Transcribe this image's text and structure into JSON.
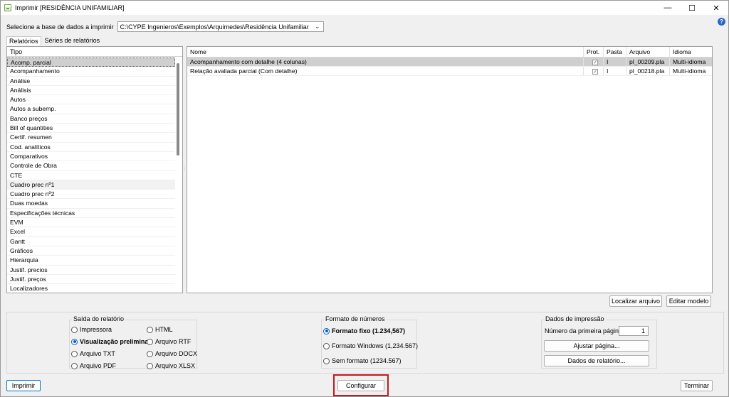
{
  "window": {
    "title": "Imprimir [RESIDÊNCIA UNIFAMILIAR]"
  },
  "database": {
    "label": "Selecione a base de dados a imprimir",
    "path": "C:\\CYPE Ingenieros\\Exemplos\\Arquimedes\\Residência Unifamiliar"
  },
  "tabs": [
    "Relatórios",
    "Séries de relatórios"
  ],
  "type_list": {
    "header": "Tipo",
    "items": [
      "Acomp. parcial",
      "Acompanhamento",
      "Análise",
      "Análisis",
      "Autos",
      "Autos a subemp.",
      "Banco preços",
      "Bill of quantities",
      "Certif. resumen",
      "Cod. analíticos",
      "Comparativos",
      "Controle de Obra",
      "CTE",
      "Cuadro prec nº1",
      "Cuadro prec nº2",
      "Duas moedas",
      "Especificações técnicas",
      "EVM",
      "Excel",
      "Gantt",
      "Gráficos",
      "Hierarquia",
      "Justif. precios",
      "Justif. preços",
      "Localizadores"
    ]
  },
  "reports_grid": {
    "columns": [
      "Nome",
      "Prot.",
      "Pasta",
      "Arquivo",
      "Idioma"
    ],
    "rows": [
      {
        "nome": "Acompanhamento com detalhe (4 colunas)",
        "pasta": "I",
        "arquivo": "pl_00209.pla",
        "idioma": "Multi-idioma"
      },
      {
        "nome": "Relação avaliada parcial (Com detalhe)",
        "pasta": "I",
        "arquivo": "pl_00218.pla",
        "idioma": "Multi-idioma"
      }
    ]
  },
  "buttons": {
    "localizar": "Localizar arquivo",
    "editar": "Editar modelo",
    "imprimir": "Imprimir",
    "configurar": "Configurar",
    "terminar": "Terminar",
    "ajustar": "Ajustar página...",
    "dados_relatorio": "Dados de relatório..."
  },
  "output": {
    "title": "Saída do relatório",
    "options": [
      "Impressora",
      "Visualização preliminar",
      "Arquivo TXT",
      "Arquivo PDF",
      "HTML",
      "Arquivo RTF",
      "Arquivo DOCX",
      "Arquivo XLSX"
    ],
    "selected": "Visualização preliminar"
  },
  "number_format": {
    "title": "Formato de números",
    "options": [
      "Formato fixo (1.234,567)",
      "Formato Windows (1,234.567)",
      "Sem formato (1234.567)"
    ],
    "selected": "Formato fixo (1.234,567)"
  },
  "print_data": {
    "title": "Dados de impressão",
    "first_page_label": "Número da primeira página",
    "first_page_value": "1"
  }
}
